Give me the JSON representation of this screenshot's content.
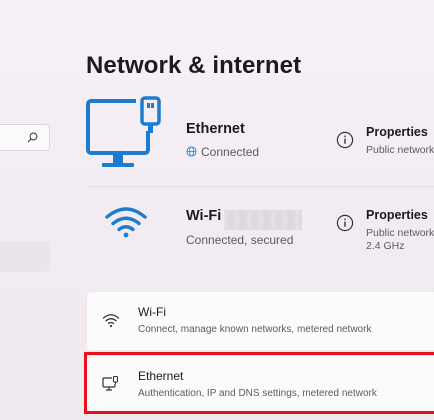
{
  "page": {
    "title": "Network & internet"
  },
  "colors": {
    "accent": "#1d7bd0",
    "highlight": "#e8101a"
  },
  "sidebar": {
    "search": {
      "icon": "search-icon"
    }
  },
  "connections": {
    "ethernet": {
      "name": "Ethernet",
      "status": "Connected",
      "status_icon": "globe-icon",
      "properties": {
        "label": "Properties",
        "detail": "Public network"
      }
    },
    "wifi": {
      "name": "Wi-Fi",
      "status": "Connected, secured",
      "properties": {
        "label": "Properties",
        "detail_line1": "Public network",
        "detail_line2": "2.4 GHz"
      }
    }
  },
  "settings": [
    {
      "title": "Wi-Fi",
      "subtitle": "Connect, manage known networks, metered network",
      "icon": "wifi-icon"
    },
    {
      "title": "Ethernet",
      "subtitle": "Authentication, IP and DNS settings, metered network",
      "icon": "ethernet-icon"
    }
  ]
}
